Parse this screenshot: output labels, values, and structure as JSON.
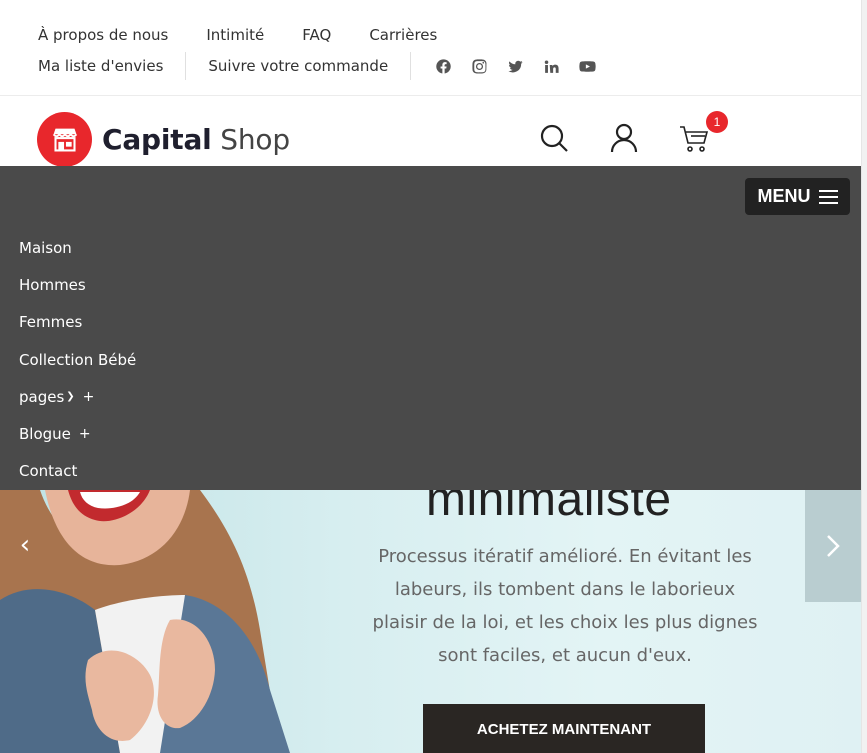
{
  "topbar": {
    "row1": [
      "À propos de nous",
      "Intimité",
      "FAQ",
      "Carrières"
    ],
    "wishlist": "Ma liste d'envies",
    "track_order": "Suivre votre commande",
    "social": [
      "facebook-icon",
      "instagram-icon",
      "twitter-icon",
      "linkedin-icon",
      "youtube-icon"
    ]
  },
  "header": {
    "logo_bold": "Capital",
    "logo_light": "Shop",
    "cart_count": "1",
    "colors": {
      "brand_red": "#e8272c",
      "dark": "#1f1f2e"
    }
  },
  "menu": {
    "button_label": "MENU",
    "items": [
      {
        "label": "Maison"
      },
      {
        "label": "Hommes"
      },
      {
        "label": "Femmes"
      },
      {
        "label": "Collection Bébé"
      },
      {
        "label": "pages",
        "has_dropdown": true,
        "plus": "+"
      },
      {
        "label": "Blogue",
        "plus": "+"
      },
      {
        "label": "Contact"
      }
    ],
    "panel_color": "#4a4a4a"
  },
  "hero": {
    "title": "minimaliste",
    "body": "Processus itératif amélioré. En évitant les labeurs, ils tombent dans le laborieux plaisir de la loi, et les choix les plus dignes sont faciles, et aucun d'eux.",
    "cta": "ACHETEZ MAINTENANT"
  }
}
